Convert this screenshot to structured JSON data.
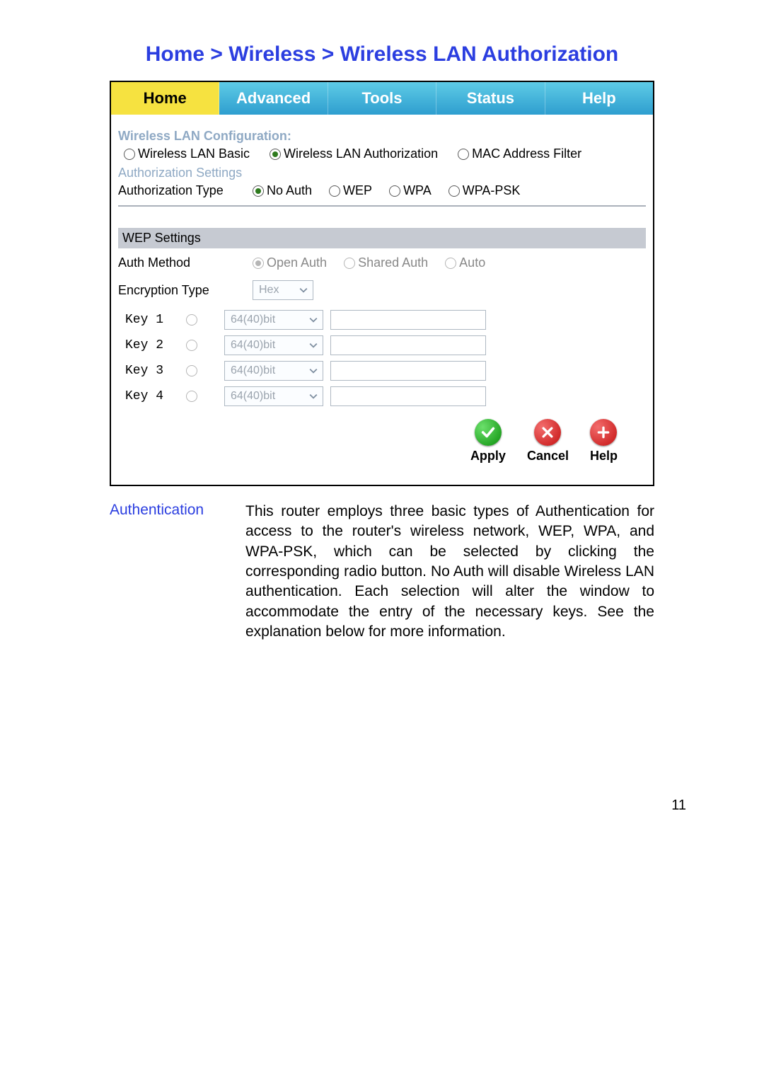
{
  "breadcrumb": "Home > Wireless > Wireless LAN Authorization",
  "tabs": [
    {
      "label": "Home",
      "active": true
    },
    {
      "label": "Advanced",
      "active": false
    },
    {
      "label": "Tools",
      "active": false
    },
    {
      "label": "Status",
      "active": false
    },
    {
      "label": "Help",
      "active": false
    }
  ],
  "wlan_config": {
    "heading": "Wireless LAN Configuration:",
    "options": [
      {
        "label": "Wireless LAN Basic",
        "checked": false
      },
      {
        "label": "Wireless LAN Authorization",
        "checked": true
      },
      {
        "label": "MAC Address Filter",
        "checked": false
      }
    ]
  },
  "auth_settings": {
    "heading": "Authorization Settings",
    "type_label": "Authorization Type",
    "options": [
      {
        "label": "No Auth",
        "checked": true
      },
      {
        "label": "WEP",
        "checked": false
      },
      {
        "label": "WPA",
        "checked": false
      },
      {
        "label": "WPA-PSK",
        "checked": false
      }
    ]
  },
  "wep": {
    "heading": "WEP Settings",
    "auth_method_label": "Auth Method",
    "auth_method_options": [
      {
        "label": "Open Auth",
        "checked": true
      },
      {
        "label": "Shared Auth",
        "checked": false
      },
      {
        "label": "Auto",
        "checked": false
      }
    ],
    "enc_type_label": "Encryption Type",
    "enc_type_value": "Hex",
    "keys": [
      {
        "label": "Key 1",
        "bits": "64(40)bit",
        "value": ""
      },
      {
        "label": "Key 2",
        "bits": "64(40)bit",
        "value": ""
      },
      {
        "label": "Key 3",
        "bits": "64(40)bit",
        "value": ""
      },
      {
        "label": "Key 4",
        "bits": "64(40)bit",
        "value": ""
      }
    ]
  },
  "buttons": {
    "apply": "Apply",
    "cancel": "Cancel",
    "help": "Help"
  },
  "description": {
    "term": "Authentication",
    "body": "This router employs three basic types of Authentication for access to the router's wireless network, WEP, WPA, and WPA-PSK, which can be selected by clicking the corresponding radio button. No Auth will disable Wireless LAN authentication. Each selection will alter the window to accommodate the entry of the necessary keys. See the explanation below for more information."
  },
  "page_number": "11"
}
